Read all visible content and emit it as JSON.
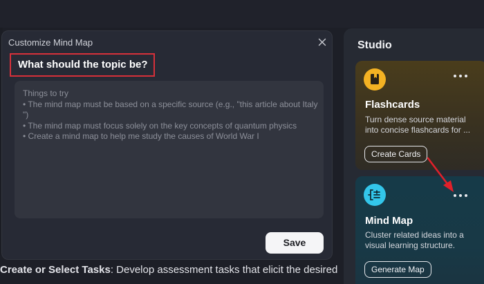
{
  "dialog": {
    "title": "Customize Mind Map",
    "question": "What should the topic be?",
    "textarea": {
      "placeholder_lines": [
        "Things to try",
        "• The mind map must be based on a specific source (e.g., \"this article about Italy",
        "\")",
        "• The mind map must focus solely on the key concepts of quantum physics",
        "• Create a mind map to help me study the causes of World War I"
      ]
    },
    "save_label": "Save"
  },
  "studio": {
    "title": "Studio",
    "cards": [
      {
        "icon": "flashcard-icon",
        "icon_color": "#f4b223",
        "title": "Flashcards",
        "description": "Turn dense source material into concise flashcards for ...",
        "button_label": "Create Cards"
      },
      {
        "icon": "mind-map-icon",
        "icon_color": "#33c6ea",
        "title": "Mind Map",
        "description": "Cluster related ideas into a visual learning structure.",
        "button_label": "Generate Map"
      }
    ]
  },
  "background": {
    "text_bold": "Create or Select Tasks",
    "text_rest": ": Develop assessment tasks that elicit the desired"
  },
  "colors": {
    "highlight_box": "#d7303a",
    "annotation_arrow": "#e0202a",
    "dialog_bg": "#272a35",
    "studio_bg": "#262a33"
  }
}
